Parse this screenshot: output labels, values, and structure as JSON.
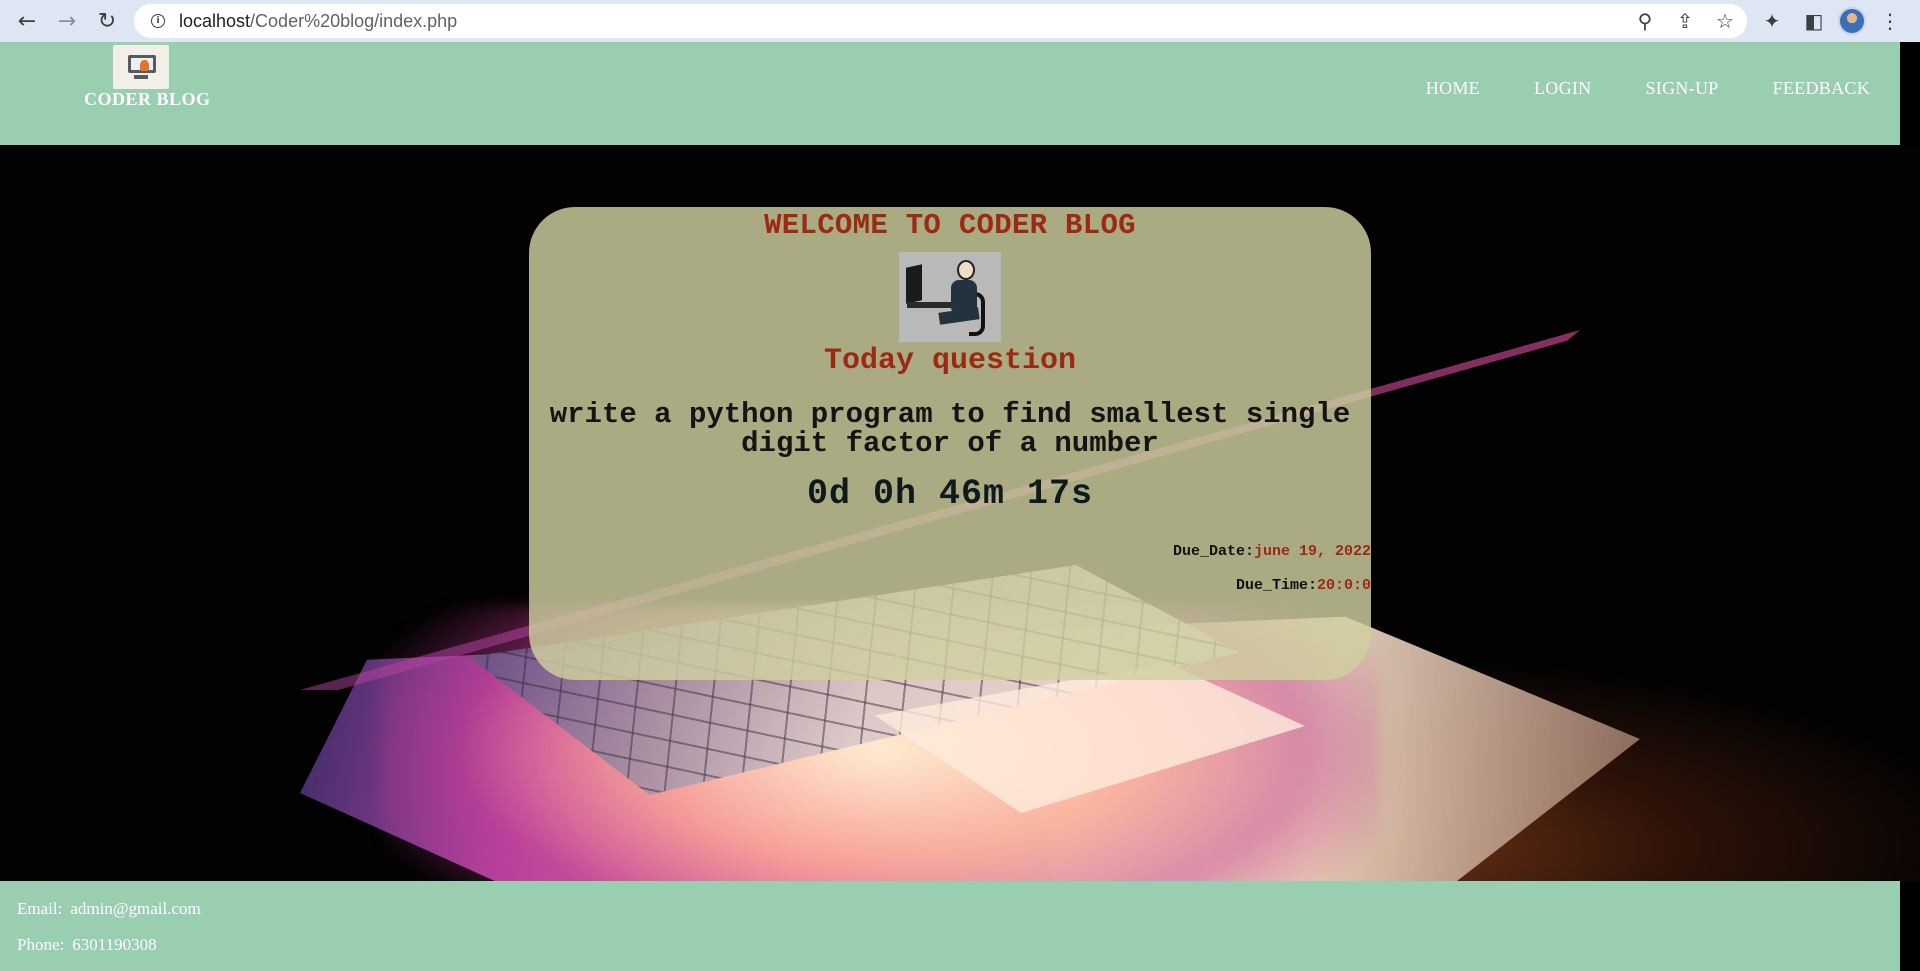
{
  "browser": {
    "url_host": "localhost",
    "url_path": "/Coder%20blog/index.php"
  },
  "header": {
    "brand": "CODER BLOG",
    "nav": [
      "HOME",
      "LOGIN",
      "SIGN-UP",
      "FEEDBACK"
    ]
  },
  "card": {
    "welcome": "WELCOME TO CODER BLOG",
    "today_title": "Today question",
    "question": "write a python program to find smallest single digit factor of a number",
    "countdown": "0d 0h 46m 17s",
    "due_date_label": "Due_Date:",
    "due_date_value": "june 19, 2022",
    "due_time_label": "Due_Time:",
    "due_time_value": "20:0:0"
  },
  "footer": {
    "email_label": "Email:",
    "email_value": "admin@gmail.com",
    "phone_label": "Phone:",
    "phone_value": "6301190308"
  },
  "colors": {
    "header_bg": "#99ceb0",
    "accent_red": "#9c2a12",
    "card_bg": "#d0d0a0"
  }
}
